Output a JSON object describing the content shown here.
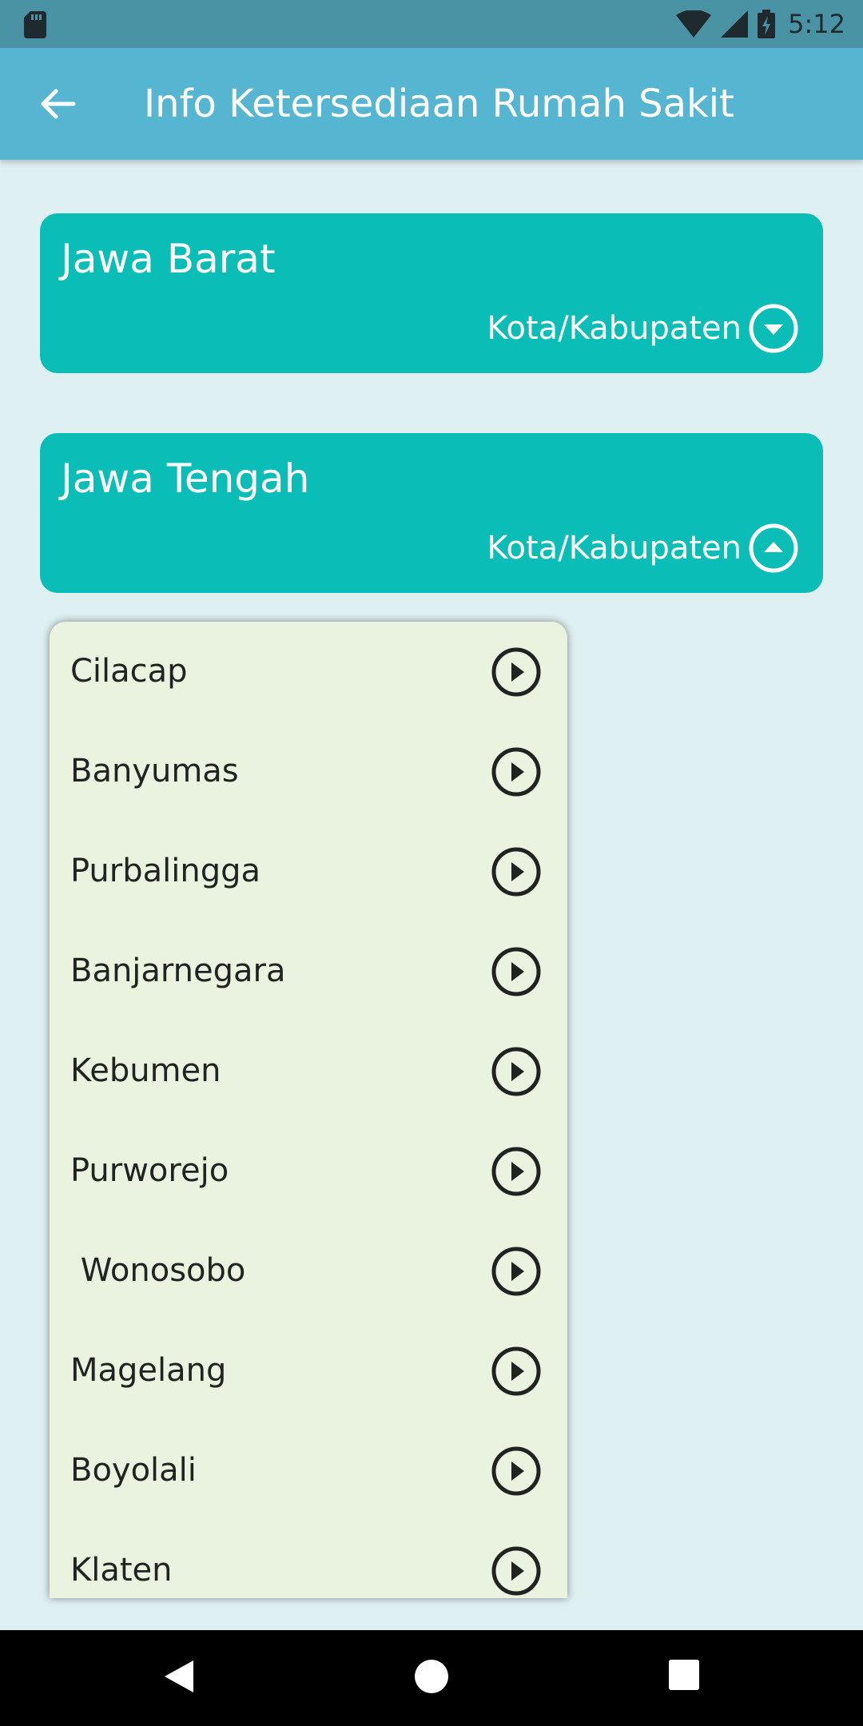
{
  "status_bar": {
    "time": "5:12"
  },
  "app_bar": {
    "title": "Info Ketersediaan Rumah Sakit"
  },
  "provinces": [
    {
      "name": "Jawa Barat",
      "sub_label": "Kota/Kabupaten",
      "expanded": false
    },
    {
      "name": "Jawa Tengah",
      "sub_label": "Kota/Kabupaten",
      "expanded": true
    }
  ],
  "regencies": [
    {
      "label": "Cilacap"
    },
    {
      "label": "Banyumas"
    },
    {
      "label": "Purbalingga"
    },
    {
      "label": "Banjarnegara"
    },
    {
      "label": "Kebumen"
    },
    {
      "label": "Purworejo"
    },
    {
      "label": " Wonosobo"
    },
    {
      "label": "Magelang"
    },
    {
      "label": "Boyolali"
    },
    {
      "label": "Klaten"
    }
  ],
  "colors": {
    "app_bar": "#56b6d1",
    "province_card": "#0bbdb7",
    "background": "#dff0f2",
    "list_background": "#eaf3df"
  }
}
